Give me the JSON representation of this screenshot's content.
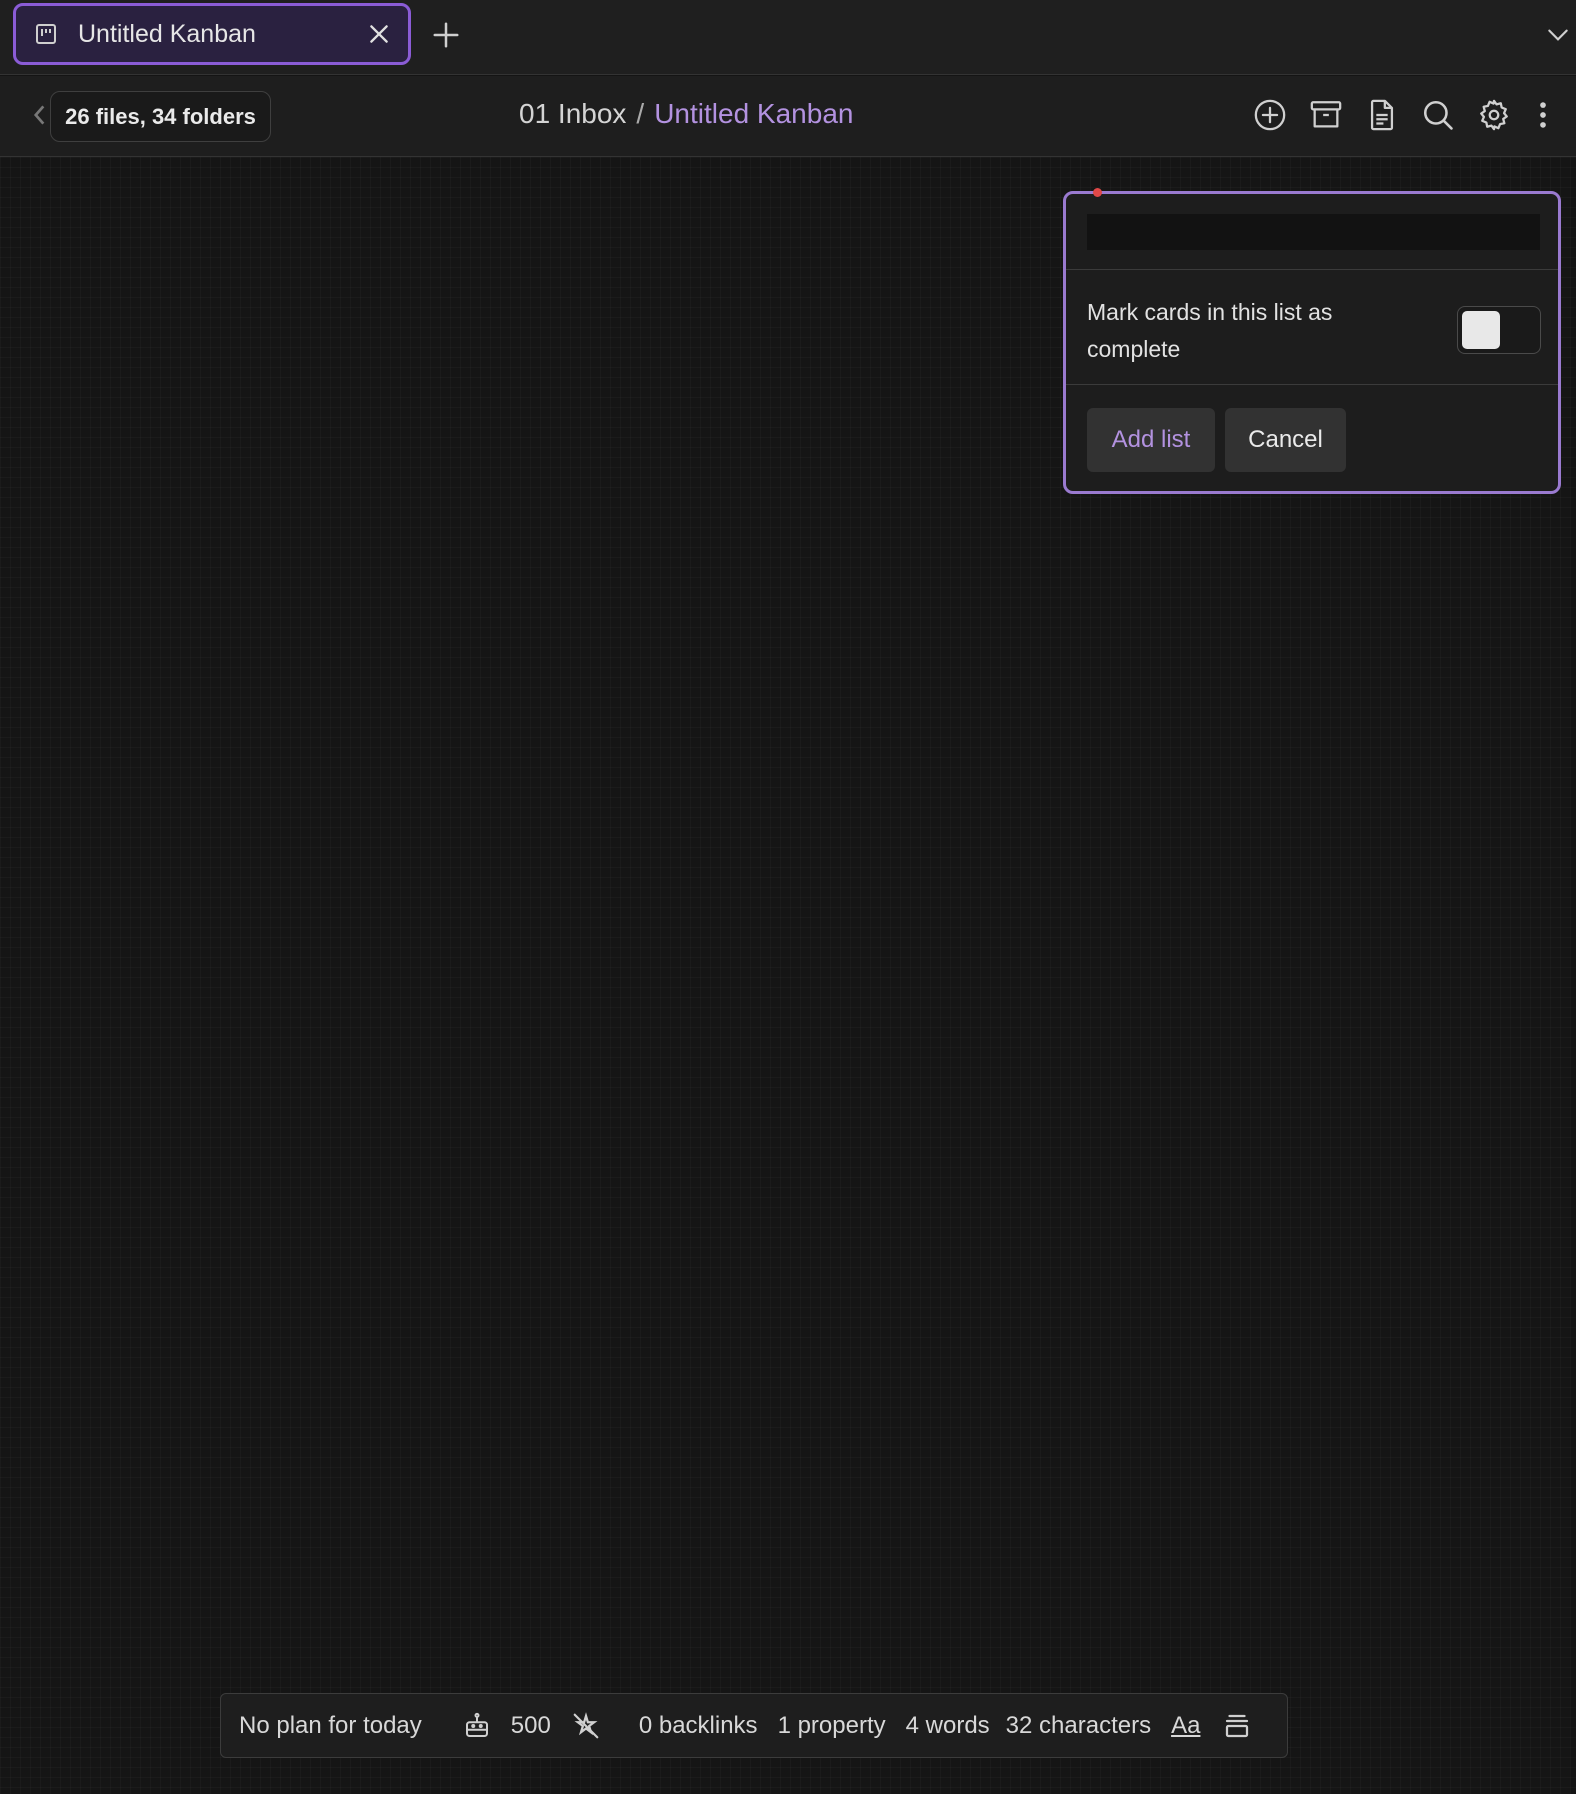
{
  "colors": {
    "accent": "#8b5cd6",
    "accent_text": "#b392e0",
    "background": "#151515"
  },
  "tabbar": {
    "tab": {
      "title": "Untitled Kanban",
      "icon": "kanban-icon"
    },
    "new_tab_icon": "plus-icon",
    "dropdown_icon": "chevron-down-icon"
  },
  "header": {
    "files_tooltip": "26 files, 34 folders",
    "breadcrumb": {
      "folder": "01 Inbox",
      "separator": "/",
      "current": "Untitled Kanban"
    },
    "actions": [
      "plus-circle-icon",
      "archive-icon",
      "document-icon",
      "search-icon",
      "gear-icon",
      "more-vertical-icon"
    ]
  },
  "add_list_form": {
    "title_value": "",
    "complete_label": "Mark cards in this list as complete",
    "complete_toggle": "off",
    "add_button": "Add list",
    "cancel_button": "Cancel"
  },
  "statusbar": {
    "plan": "No plan for today",
    "count": "500",
    "backlinks": "0 backlinks",
    "properties": "1 property",
    "words": "4 words",
    "characters": "32 characters",
    "font_toggle": "Aa"
  }
}
